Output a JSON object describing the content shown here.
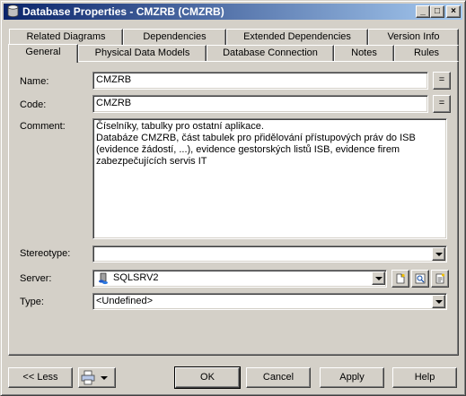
{
  "window": {
    "title": "Database Properties - CMZRB (CMZRB)",
    "controls": [
      "_",
      "□",
      "×"
    ]
  },
  "tabs": {
    "row_back": [
      "Related Diagrams",
      "Dependencies",
      "Extended Dependencies",
      "Version Info"
    ],
    "row_front": [
      "General",
      "Physical Data Models",
      "Database Connection",
      "Notes",
      "Rules"
    ],
    "active": "General"
  },
  "form": {
    "name_label": "Name:",
    "name_value": "CMZRB",
    "code_label": "Code:",
    "code_value": "CMZRB",
    "equals_label": "=",
    "comment_label": "Comment:",
    "comment_value": "Číselníky, tabulky pro ostatní aplikace.\nDatabáze CMZRB, část tabulek pro přidělování přístupových práv do ISB\n(evidence žádostí, ...), evidence gestorských listů ISB, evidence firem\nzabezpečujících servis IT",
    "stereotype_label": "Stereotype:",
    "stereotype_value": "",
    "server_label": "Server:",
    "server_value": "SQLSRV2",
    "type_label": "Type:",
    "type_value": "<Undefined>"
  },
  "footer": {
    "less_label": "<< Less",
    "ok_label": "OK",
    "cancel_label": "Cancel",
    "apply_label": "Apply",
    "help_label": "Help"
  },
  "colors": {
    "title_start": "#0a246a",
    "title_end": "#a6caf0",
    "face": "#d4d0c8"
  }
}
